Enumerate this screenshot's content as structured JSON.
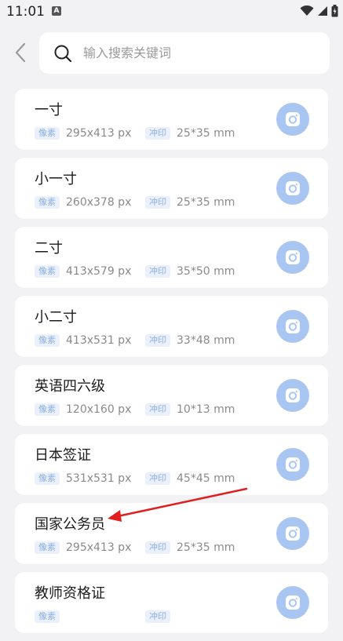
{
  "status_bar": {
    "time": "11:01",
    "app_icon_letter": "A"
  },
  "search": {
    "placeholder": "输入搜索关键词",
    "value": ""
  },
  "labels": {
    "pixel_tag": "像素",
    "print_tag": "冲印"
  },
  "items": [
    {
      "title": "一寸",
      "pixel": "295x413 px",
      "print": "25*35 mm"
    },
    {
      "title": "小一寸",
      "pixel": "260x378 px",
      "print": "25*35 mm"
    },
    {
      "title": "二寸",
      "pixel": "413x579 px",
      "print": "35*50 mm"
    },
    {
      "title": "小二寸",
      "pixel": "413x531 px",
      "print": "33*48 mm"
    },
    {
      "title": "英语四六级",
      "pixel": "120x160 px",
      "print": "10*13 mm"
    },
    {
      "title": "日本签证",
      "pixel": "531x531 px",
      "print": "45*45 mm"
    },
    {
      "title": "国家公务员",
      "pixel": "295x413 px",
      "print": "25*35 mm"
    },
    {
      "title": "教师资格证",
      "pixel": "",
      "print": ""
    }
  ],
  "colors": {
    "accent": "#a9c6f2",
    "annotation_arrow": "#e02020"
  },
  "icons": {
    "back": "chevron-left-icon",
    "search": "search-icon",
    "camera": "camera-icon",
    "wifi": "wifi-icon",
    "signal": "signal-icon",
    "battery": "battery-icon"
  }
}
